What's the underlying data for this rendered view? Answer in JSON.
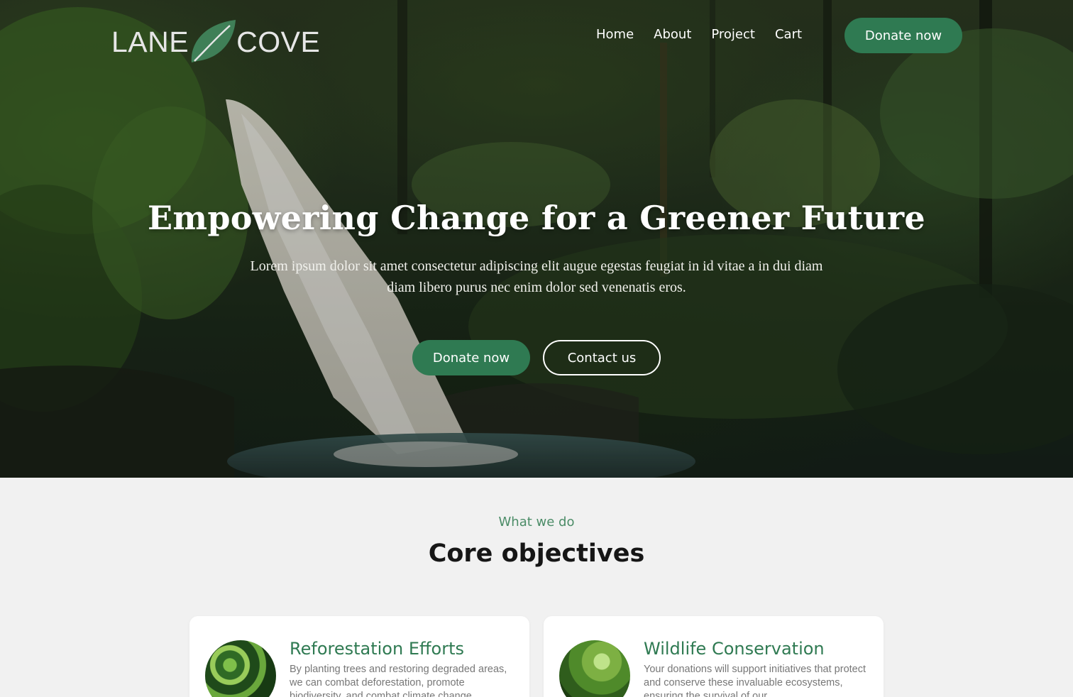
{
  "brand": {
    "left": "LANE",
    "right": "COVE",
    "leaf_color": "#3f7f57"
  },
  "nav": {
    "links": [
      "Home",
      "About",
      "Project",
      "Cart"
    ],
    "donate_label": "Donate now"
  },
  "hero": {
    "title": "Empowering Change for a Greener Future",
    "subtitle": "Lorem ipsum dolor sit amet consectetur adipiscing elit augue egestas feugiat in id vitae a in dui diam diam libero purus nec enim dolor sed venenatis eros.",
    "primary_button": "Donate now",
    "secondary_button": "Contact us"
  },
  "section": {
    "eyebrow": "What we do",
    "title": "Core objectives"
  },
  "cards": [
    {
      "title": "Reforestation Efforts",
      "text": "By planting trees and restoring degraded areas, we can combat deforestation, promote biodiversity, and combat climate change."
    },
    {
      "title": "Wildlife Conservation",
      "text": "Your donations will support initiatives that protect and conserve these invaluable ecosystems, ensuring the survival of our"
    }
  ],
  "colors": {
    "accent": "#2f7a52",
    "eyebrow": "#4b8c67",
    "background": "#f1f1f1"
  }
}
